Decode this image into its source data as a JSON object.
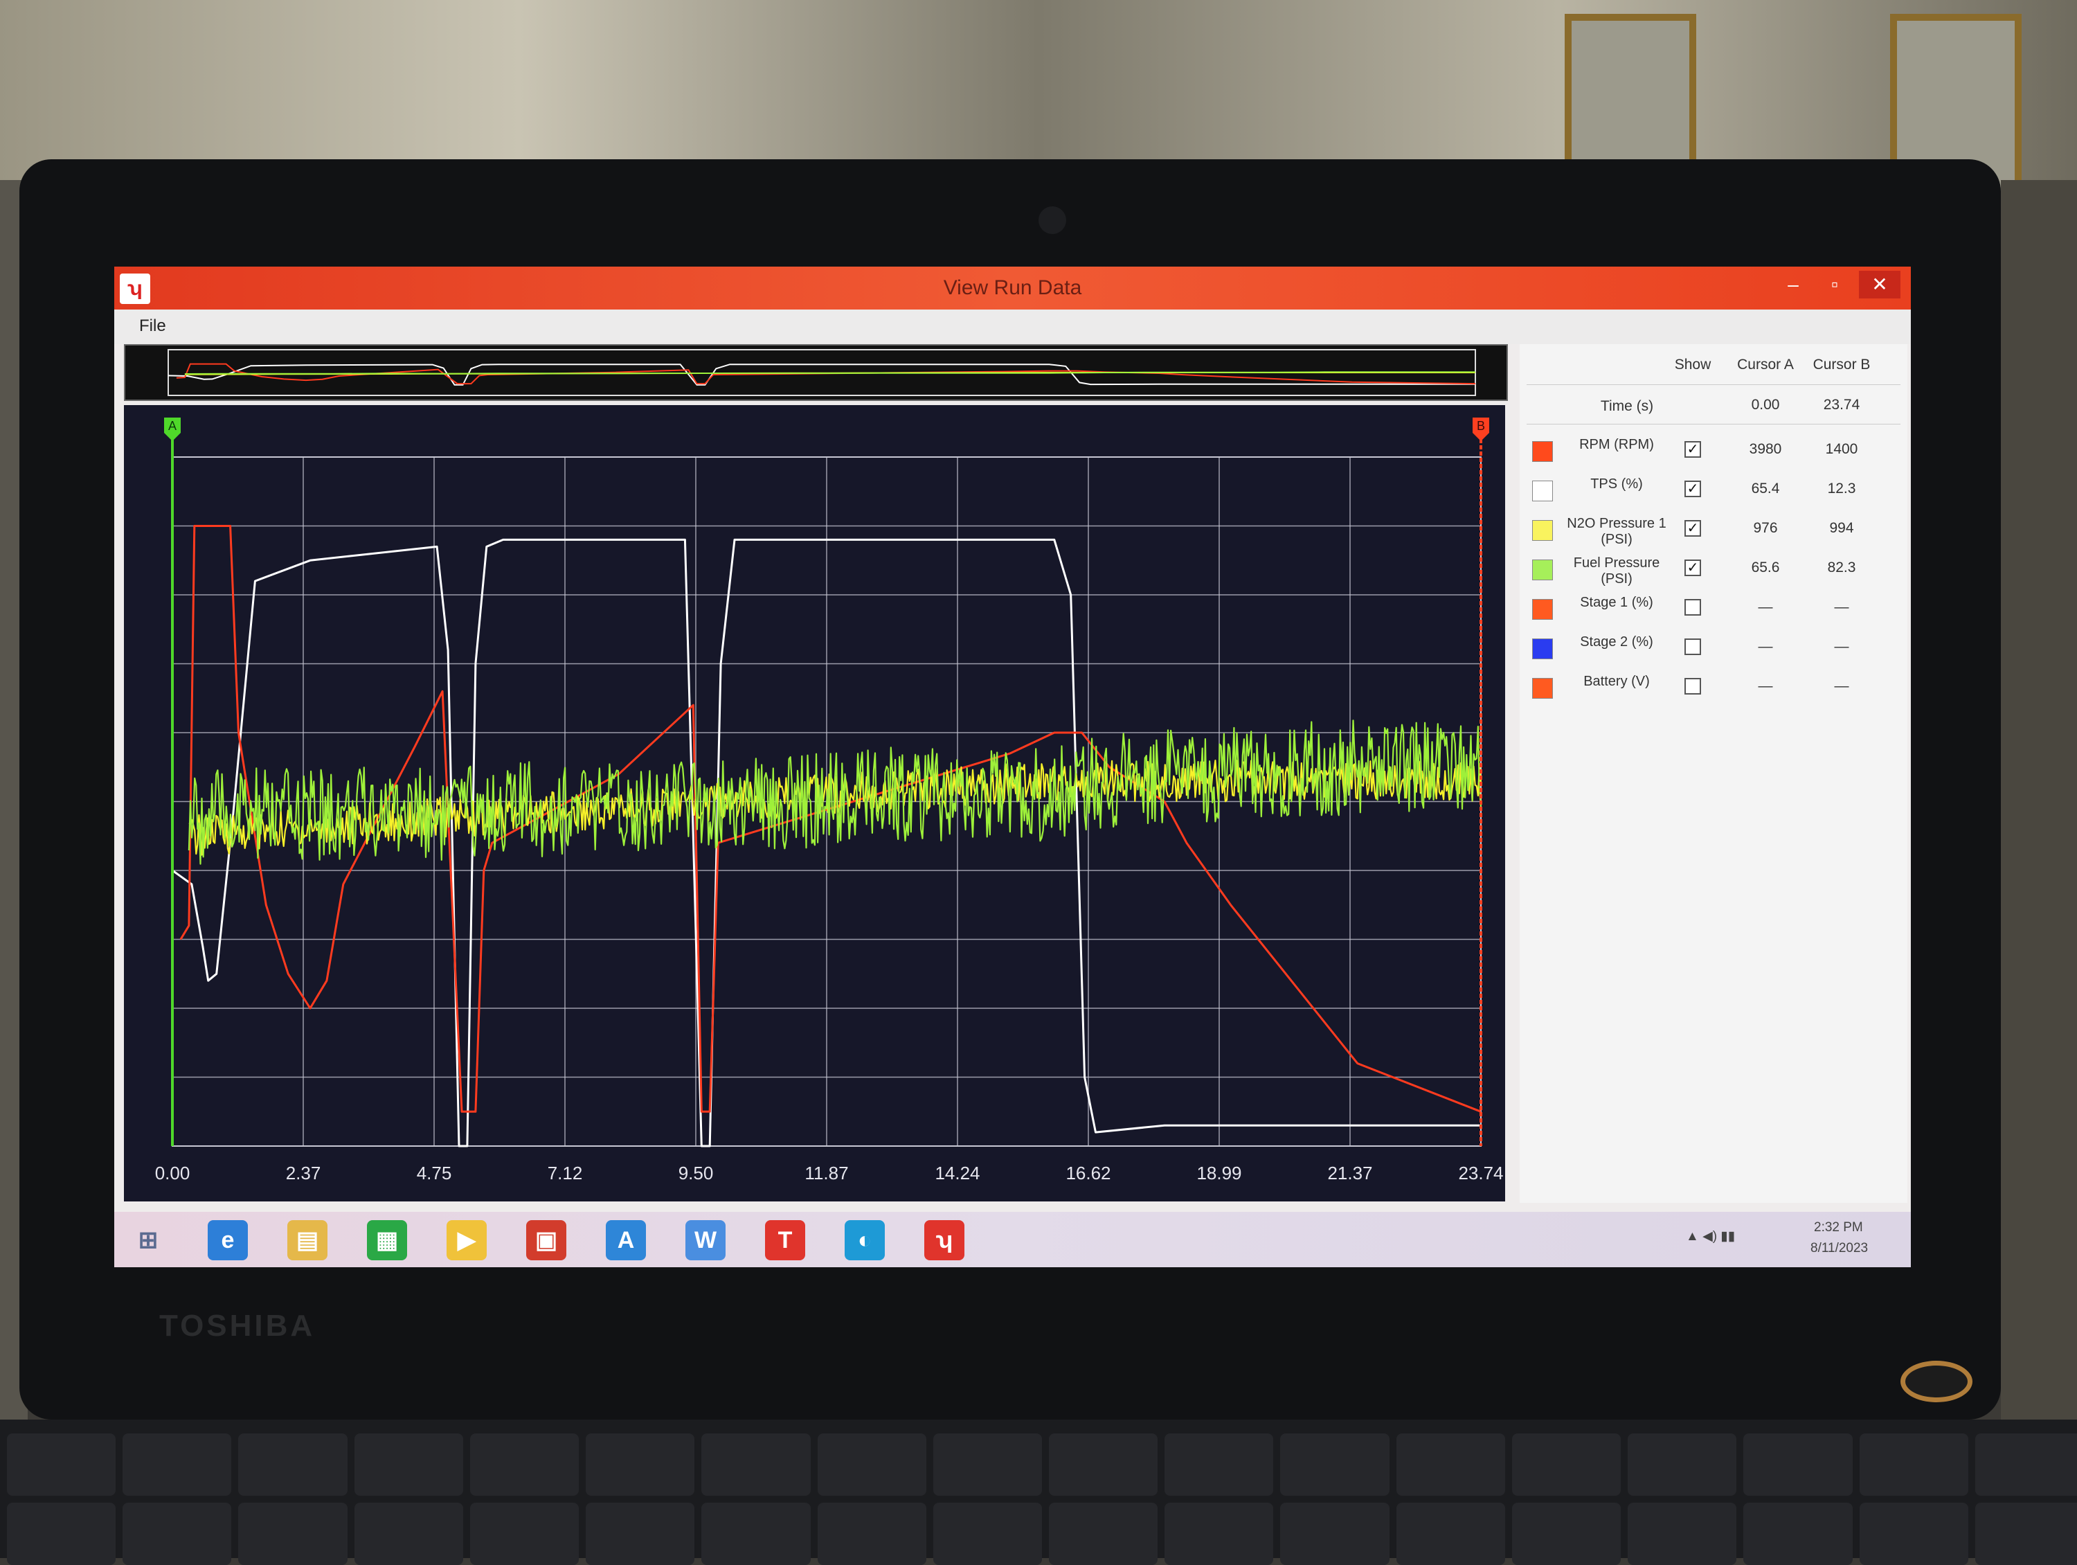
{
  "window": {
    "title": "View Run Data",
    "menu_file": "File"
  },
  "colors": {
    "rpm": "#ff3b1f",
    "tps": "#ffffff",
    "n2o": "#f7f12a",
    "fuel": "#9ef03a",
    "cursor_a": "#4fd82a",
    "cursor_b": "#ff4020",
    "plot_bg": "#161729",
    "grid": "#c8c8d4"
  },
  "cursors": {
    "a_label": "A",
    "b_label": "B"
  },
  "table": {
    "headers": {
      "show": "Show",
      "cursor_a": "Cursor A",
      "cursor_b": "Cursor B"
    },
    "time_row": {
      "label": "Time (s)",
      "a": "0.00",
      "b": "23.74"
    },
    "channels": [
      {
        "label": "RPM (RPM)",
        "color": "#ff4a1c",
        "shown": true,
        "a": "3980",
        "b": "1400"
      },
      {
        "label": "TPS (%)",
        "color": "#ffffff",
        "shown": true,
        "a": "65.4",
        "b": "12.3"
      },
      {
        "label": "N2O Pressure 1 (PSI)",
        "color": "#f9f35e",
        "shown": true,
        "a": "976",
        "b": "994"
      },
      {
        "label": "Fuel Pressure (PSI)",
        "color": "#a6ef5a",
        "shown": true,
        "a": "65.6",
        "b": "82.3"
      },
      {
        "label": "Stage 1 (%)",
        "color": "#ff5a20",
        "shown": false,
        "a": "—",
        "b": "—"
      },
      {
        "label": "Stage 2 (%)",
        "color": "#2a3cf0",
        "shown": false,
        "a": "—",
        "b": "—"
      },
      {
        "label": "Battery (V)",
        "color": "#ff5a20",
        "shown": false,
        "a": "—",
        "b": "—"
      }
    ]
  },
  "chart_data": {
    "type": "line",
    "x_ticks": [
      "0.00",
      "2.37",
      "4.75",
      "7.12",
      "9.50",
      "11.87",
      "14.24",
      "16.62",
      "18.99",
      "21.37",
      "23.74"
    ],
    "xlim": [
      0,
      23.74
    ],
    "grid": true,
    "series": [
      {
        "name": "TPS (%)",
        "color": "#ffffff",
        "x": [
          0,
          0.35,
          0.55,
          0.65,
          0.8,
          1.1,
          1.5,
          2.5,
          4.8,
          5.0,
          5.2,
          5.35,
          5.5,
          5.7,
          6.0,
          9.3,
          9.45,
          9.6,
          9.75,
          9.95,
          10.2,
          16.0,
          16.3,
          16.55,
          16.75,
          18.0,
          20.0,
          23.74
        ],
        "y": [
          40,
          38,
          29,
          24,
          25,
          48,
          82,
          85,
          87,
          72,
          0,
          0,
          70,
          87,
          88,
          88,
          45,
          0,
          0,
          70,
          88,
          88,
          80,
          10,
          2,
          3,
          3,
          3
        ]
      },
      {
        "name": "RPM (RPM)",
        "color": "#ff3b1f",
        "x": [
          0.15,
          0.3,
          0.4,
          1.05,
          1.2,
          1.7,
          2.1,
          2.5,
          2.8,
          3.1,
          4.4,
          4.9,
          5.25,
          5.5,
          5.65,
          5.8,
          8.1,
          9.45,
          9.6,
          9.75,
          9.9,
          15.2,
          16.0,
          16.5,
          17.0,
          18.0,
          18.4,
          19.2,
          21.5,
          23.74
        ],
        "y": [
          30,
          32,
          90,
          90,
          60,
          35,
          25,
          20,
          24,
          38,
          58,
          66,
          5,
          5,
          40,
          44,
          54,
          64,
          5,
          5,
          44,
          57,
          60,
          60,
          55,
          50,
          44,
          35,
          12,
          5
        ]
      },
      {
        "name": "N2O Pressure 1 (PSI)",
        "color": "#f7f12a",
        "x": [
          0.3,
          2.0,
          4.0,
          5.3,
          6.0,
          8.0,
          10.0,
          12.0,
          14.0,
          16.0,
          17.5,
          19.0,
          21.0,
          23.74
        ],
        "y": [
          45,
          46,
          47,
          48,
          48,
          49,
          50,
          51,
          52,
          53,
          53,
          53,
          53,
          53
        ]
      },
      {
        "name": "Fuel Pressure (PSI)",
        "color": "#9ef03a",
        "x": [
          0.3,
          1.0,
          2.0,
          3.0,
          4.0,
          5.0,
          6.0,
          7.0,
          8.0,
          9.0,
          10.0,
          11.0,
          12.0,
          13.0,
          14.0,
          15.0,
          16.0,
          17.0,
          18.0,
          19.0,
          20.0,
          21.0,
          22.0,
          23.74
        ],
        "y": [
          47,
          48,
          48,
          48,
          49,
          48,
          49,
          49,
          49,
          50,
          50,
          50,
          50,
          51,
          51,
          51,
          51,
          53,
          54,
          54,
          54,
          55,
          55,
          55
        ]
      }
    ]
  },
  "overview": {
    "xlim": [
      0,
      23.74
    ]
  },
  "taskbar": {
    "icons": [
      "windows-start-icon",
      "internet-explorer-icon",
      "file-explorer-icon",
      "store-icon",
      "media-icon",
      "app-red-icon",
      "app-blue-icon",
      "word-icon",
      "app-t-icon",
      "edge-icon",
      "nx-app-icon"
    ],
    "time": "2:32 PM",
    "date": "8/11/2023"
  },
  "hardware": {
    "brand": "TOSHIBA"
  }
}
